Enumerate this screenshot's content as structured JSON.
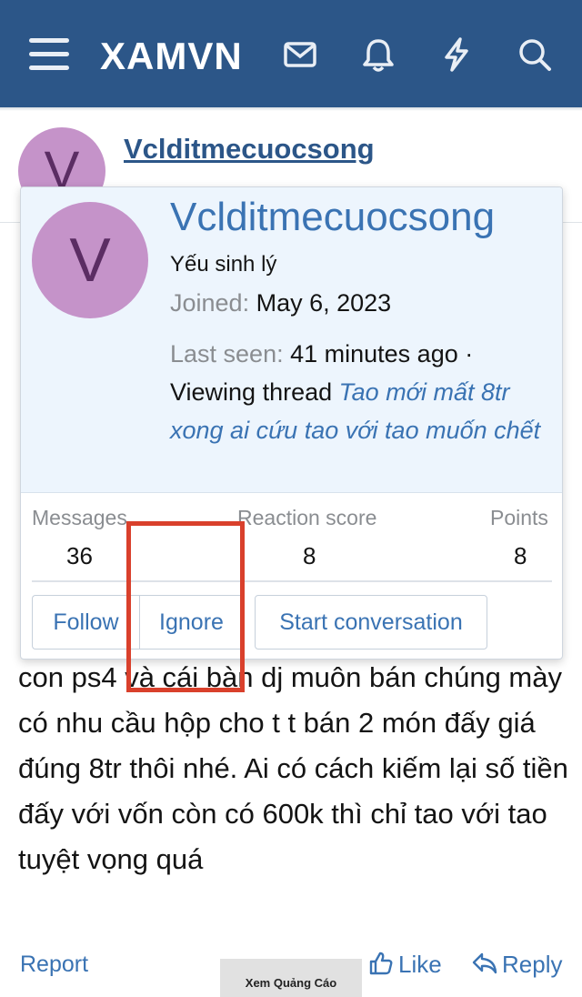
{
  "header": {
    "logo": "XAMVN",
    "icons": [
      "menu-icon",
      "mail-icon",
      "bell-icon",
      "lightning-icon",
      "search-icon"
    ],
    "bg_color": "#2c5688"
  },
  "author": {
    "avatar_letter": "V",
    "username": "Vclditmecuocsong"
  },
  "popup": {
    "avatar_letter": "V",
    "username": "Vclditmecuocsong",
    "user_title": "Yếu sinh lý",
    "joined_label": "Joined:",
    "joined_value": "May 6, 2023",
    "last_seen_label": "Last seen:",
    "last_seen_value": "41 minutes ago ·",
    "activity_prefix": "Viewing thread",
    "activity_link": "Tao mới mất 8tr xong ai cứu tao với tao muốn chết",
    "stats": [
      {
        "label": "Messages",
        "value": "36"
      },
      {
        "label": "Reaction score",
        "value": "8"
      },
      {
        "label": "Points",
        "value": "8"
      }
    ],
    "buttons": {
      "follow": "Follow",
      "ignore": "Ignore",
      "start": "Start conversation"
    }
  },
  "post": {
    "body": "con ps4 và cái bàn dj muôn bán chúng mày có nhu cầu hộp cho t t bán 2 món đấy giá đúng 8tr thôi nhé. Ai có cách kiếm lại số tiền đấy với vốn còn có 600k thì chỉ tao với tao tuyệt vọng quá"
  },
  "footer": {
    "report": "Report",
    "like": "Like",
    "reply": "Reply",
    "ad": "Xem Quảng Cáo"
  },
  "colors": {
    "accent": "#3a73b3",
    "highlight": "#d9402c",
    "popup_bg": "#edf5fd",
    "avatar": "#c593c9"
  }
}
